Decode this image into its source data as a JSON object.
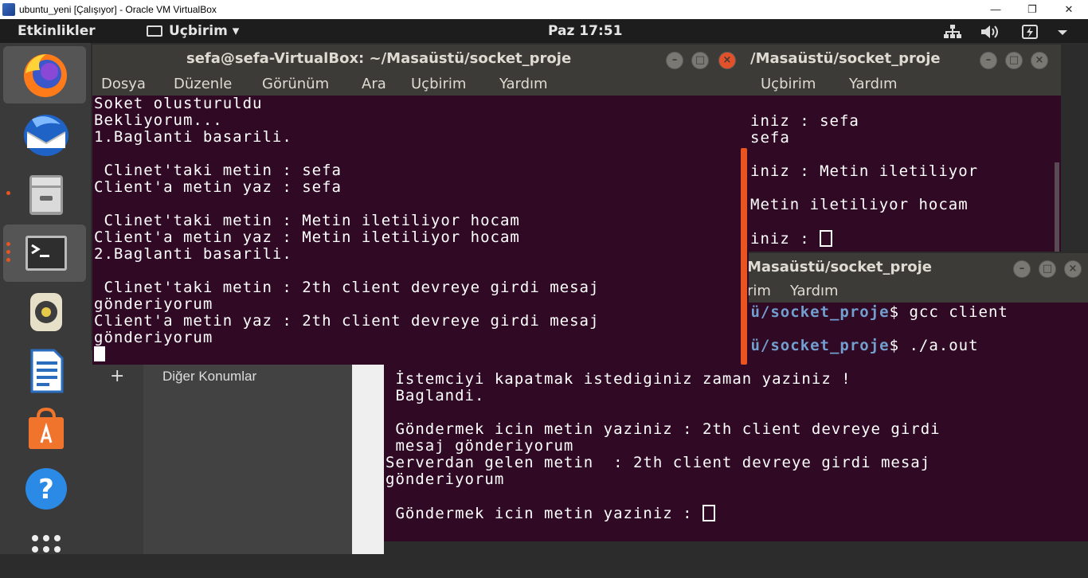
{
  "host_window": {
    "title": "ubuntu_yeni [Çalışıyor] - Oracle VM VirtualBox",
    "minimize": "—",
    "restore": "❐",
    "close": "✕"
  },
  "topbar": {
    "activities": "Etkinlikler",
    "app_menu": "Uçbirim ▾",
    "clock": "Paz 17:51",
    "tray": [
      "network-icon",
      "volume-icon",
      "battery-icon",
      "system-menu-icon"
    ]
  },
  "dock": {
    "items": [
      "firefox-icon",
      "thunderbird-icon",
      "files-icon",
      "terminal-icon",
      "rhythmbox-icon",
      "writer-icon",
      "software-icon",
      "help-icon",
      "show-apps-icon"
    ]
  },
  "files": {
    "plus": "+",
    "other_locations": "Diğer Konumlar"
  },
  "term_back": {
    "title": "/Masaüstü/socket_proje",
    "menu": [
      "Uçbirim",
      "Yardım"
    ],
    "lines": [
      "iniz : sefa",
      "sefa",
      "",
      "iniz : Metin iletiliyor",
      "",
      "Metin iletiliyor hocam",
      "",
      "iniz : "
    ]
  },
  "term_client": {
    "title": "Masaüstü/socket_proje",
    "menu": [
      "rim",
      "Yardım"
    ],
    "prompt_path": "tü/socket_proje",
    "cmd1": "$ gcc client",
    "cmd2": "$ ./a.out",
    "out1": " İstemciyi kapatmak istediginiz zaman yaziniz !\n Baglandi.\n\n Göndermek icin metin yaziniz : 2th client devreye girdi\n mesaj gönderiyorum\nServerdan gelen metin  : 2th client devreye girdi mesaj\ngönderiyorum\n\n Göndermek icin metin yaziniz : "
  },
  "term_server": {
    "title": "sefa@sefa-VirtualBox: ~/Masaüstü/socket_proje",
    "menu": [
      "Dosya",
      "Düzenle",
      "Görünüm",
      "Ara",
      "Uçbirim",
      "Yardım"
    ],
    "output": "Soket olusturuldu\nBekliyorum...\n1.Baglanti basarili.\n\n Clinet'taki metin : sefa\nClient'a metin yaz : sefa\n\n Clinet'taki metin : Metin iletiliyor hocam\nClient'a metin yaz : Metin iletiliyor hocam\n2.Baglanti basarili.\n\n Clinet'taki metin : 2th client devreye girdi mesaj\ngönderiyorum\nClient'a metin yaz : 2th client devreye girdi mesaj\ngönderiyorum"
  },
  "colors": {
    "terminal_bg": "#300a24",
    "titlebar": "#3c3b37",
    "close_button": "#e2512a",
    "accent": "#e95420"
  }
}
